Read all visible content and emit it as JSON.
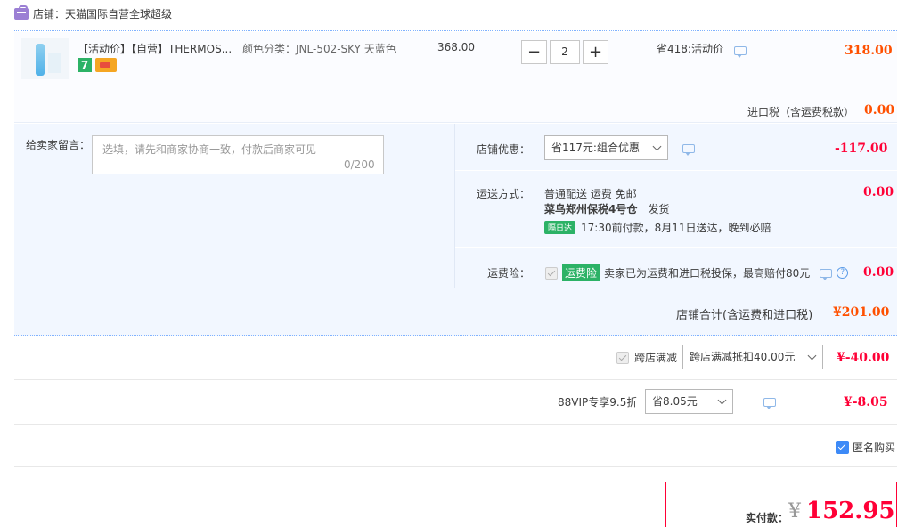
{
  "shop": {
    "label": "店铺：",
    "name": "天猫国际自营全球超级"
  },
  "item": {
    "title": "【活动价】【自营】THERMOS...",
    "sku": "颜色分类：JNL-502-SKY 天蓝色",
    "unit_price": "368.00",
    "qty": "2",
    "promo": "省418:活动价",
    "subtotal": "318.00",
    "tax_label": "进口税（含运费税款）",
    "tax_value": "0.00",
    "tag_number": "7"
  },
  "message": {
    "label": "给卖家留言：",
    "placeholder": "选填，请先和商家协商一致，付款后商家可见",
    "count": "0/200"
  },
  "discount": {
    "label": "店铺优惠：",
    "selected": "省117元:组合优惠",
    "value": "-117.00"
  },
  "shipping": {
    "label": "运送方式：",
    "method": "普通配送 运费 免邮",
    "warehouse": "菜鸟郑州保税4号仓",
    "warehouse_suffix": "发货",
    "badge": "隔日达",
    "eta": "17:30前付款，8月11日送达，晚到必赔",
    "value": "0.00"
  },
  "insurance": {
    "label": "运费险：",
    "badge": "运费险",
    "text": "卖家已为运费和进口税投保，最高赔付80元",
    "value": "0.00"
  },
  "shop_total": {
    "label": "店铺合计(含运费和进口税)",
    "value": "¥201.00"
  },
  "cross_store": {
    "label": "跨店满减",
    "selected": "跨店满减抵扣40.00元",
    "value": "¥-40.00"
  },
  "vip": {
    "label": "88VIP专享9.5折",
    "selected": "省8.05元",
    "value": "¥-8.05"
  },
  "anonymous": {
    "label": "匿名购买"
  },
  "payment": {
    "label": "实付款：",
    "currency": "¥",
    "amount": "152.95"
  },
  "colors": {
    "accent": "#ff0036",
    "orange": "#ff5000",
    "blue_bg": "#f2f7ff",
    "green": "#2cb266"
  }
}
